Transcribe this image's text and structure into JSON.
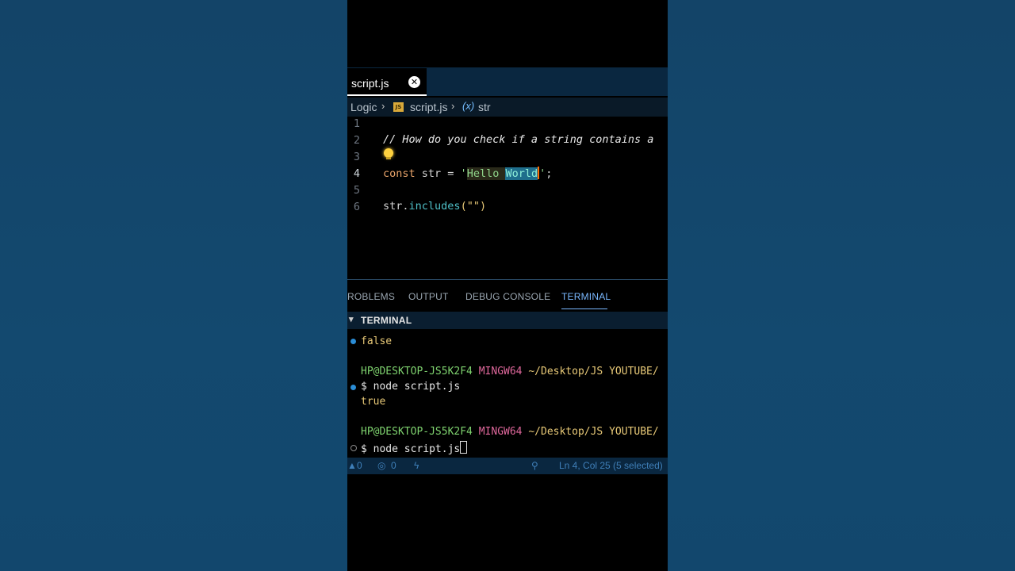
{
  "editor": {
    "tab": {
      "label": "script.js",
      "close_glyph": "✕"
    },
    "breadcrumb": {
      "folder": "Logic",
      "file": "script.js",
      "symbol_icon": "(x)",
      "symbol": "str",
      "file_icon": "JS"
    },
    "lines": [
      {
        "num": "1"
      },
      {
        "num": "2",
        "comment": "// How do you check if a string contains a"
      },
      {
        "num": "3"
      },
      {
        "num": "4",
        "kw": "const",
        "rest_a": " str = ",
        "quote_open": "'",
        "str_a": "Hello",
        "space": " ",
        "str_sel": "World",
        "quote_close": "'",
        "semi": ";"
      },
      {
        "num": "5"
      },
      {
        "num": "6",
        "obj": "str",
        "dot": ".",
        "method": "includes",
        "args": "(\"\")"
      }
    ]
  },
  "panel": {
    "tabs": [
      "ROBLEMS",
      "OUTPUT",
      "DEBUG CONSOLE",
      "TERMINAL"
    ],
    "active_tab": "TERMINAL",
    "section_title": "TERMINAL"
  },
  "terminal": {
    "line1": "false",
    "prompt1_user": "HP@DESKTOP-JS5K2F4",
    "prompt1_shell": "MINGW64",
    "prompt1_path": "~/Desktop/JS YOUTUBE/",
    "cmd1": "$ node script.js",
    "line_true": "true",
    "prompt2_user": "HP@DESKTOP-JS5K2F4",
    "prompt2_shell": "MINGW64",
    "prompt2_path": "~/Desktop/JS YOUTUBE/",
    "cmd2": "$ node script.js"
  },
  "statusbar": {
    "errors": "0",
    "ports": "0",
    "position": "Ln 4, Col 25 (5 selected)"
  },
  "colors": {
    "background": "#14466b",
    "accent": "#7ab8ff",
    "string": "#8fd48a",
    "keyword": "#e9a46a"
  }
}
